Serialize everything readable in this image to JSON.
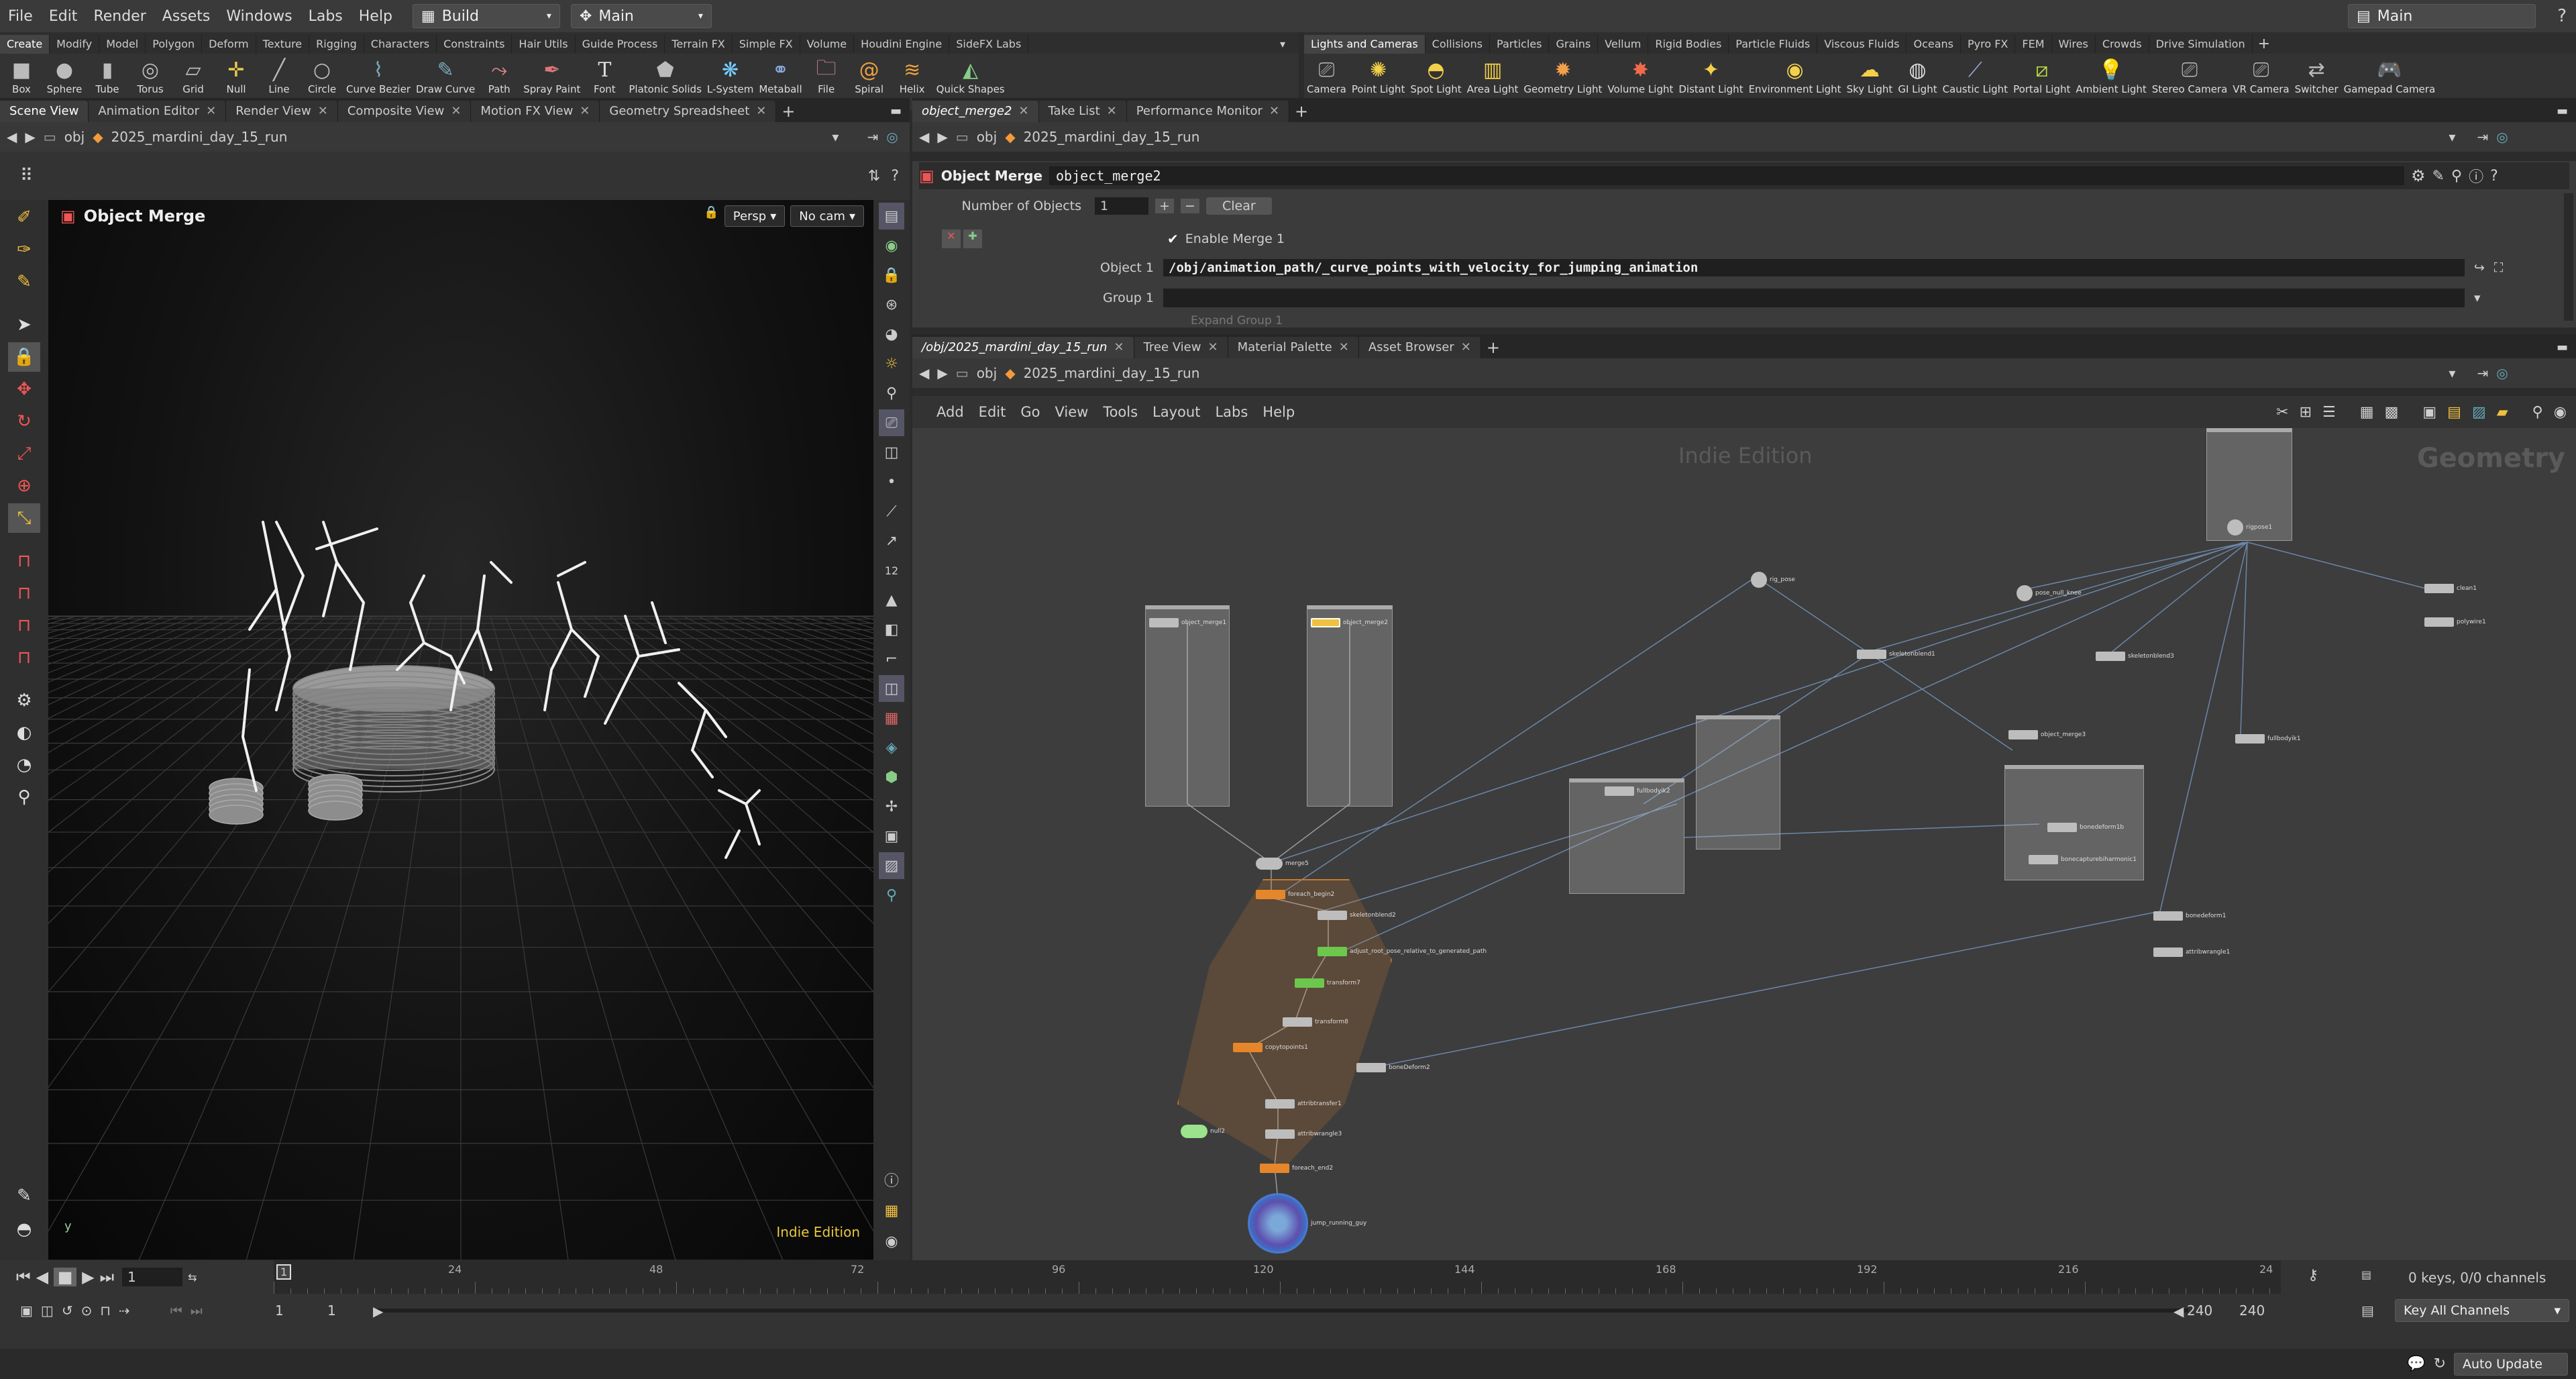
{
  "menubar": {
    "items": [
      "File",
      "Edit",
      "Render",
      "Assets",
      "Windows",
      "Labs",
      "Help"
    ],
    "build_label": "Build",
    "main_label": "Main",
    "right_main_label": "Main"
  },
  "shelf_left": {
    "tabs": [
      "Create",
      "Modify",
      "Model",
      "Polygon",
      "Deform",
      "Texture",
      "Rigging",
      "Characters",
      "Constraints",
      "Hair Utils",
      "Guide Process",
      "Terrain FX",
      "Simple FX",
      "Volume",
      "Houdini Engine",
      "SideFX Labs"
    ],
    "tools": [
      "Box",
      "Sphere",
      "Tube",
      "Torus",
      "Grid",
      "Null",
      "Line",
      "Circle",
      "Curve Bezier",
      "Draw Curve",
      "Path",
      "Spray Paint",
      "Font",
      "Platonic Solids",
      "L-System",
      "Metaball",
      "File",
      "Spiral",
      "Helix",
      "Quick Shapes"
    ]
  },
  "shelf_right": {
    "tabs": [
      "Lights and Cameras",
      "Collisions",
      "Particles",
      "Grains",
      "Vellum",
      "Rigid Bodies",
      "Particle Fluids",
      "Viscous Fluids",
      "Oceans",
      "Pyro FX",
      "FEM",
      "Wires",
      "Crowds",
      "Drive Simulation"
    ],
    "tools": [
      "Camera",
      "Point Light",
      "Spot Light",
      "Area Light",
      "Geometry Light",
      "Volume Light",
      "Distant Light",
      "Environment Light",
      "Sky Light",
      "GI Light",
      "Caustic Light",
      "Portal Light",
      "Ambient Light",
      "Stereo Camera",
      "VR Camera",
      "Switcher",
      "Gamepad Camera"
    ]
  },
  "left_pane": {
    "tabs": [
      "Scene View",
      "Animation Editor",
      "Render View",
      "Composite View",
      "Motion FX View",
      "Geometry Spreadsheet"
    ],
    "path_obj": "obj",
    "path_node": "2025_mardini_day_15_run",
    "viewport_title": "Object Merge",
    "persp_label": "Persp",
    "cam_label": "No cam",
    "edition": "Indie Edition",
    "axis_label": "y"
  },
  "param_pane": {
    "tabs": [
      "object_merge2",
      "Take List",
      "Performance Monitor"
    ],
    "path_obj": "obj",
    "path_node": "2025_mardini_day_15_run",
    "node_type": "Object Merge",
    "node_name": "object_merge2",
    "num_objects_label": "Number of Objects",
    "num_objects_value": "1",
    "clear_label": "Clear",
    "enable_merge_label": "Enable Merge 1",
    "object1_label": "Object 1",
    "object1_value": "/obj/animation_path/_curve_points_with_velocity_for_jumping_animation",
    "group1_label": "Group 1",
    "expand_group_label": "Expand Group 1"
  },
  "network_pane": {
    "tabs": [
      "/obj/2025_mardini_day_15_run",
      "Tree View",
      "Material Palette",
      "Asset Browser"
    ],
    "path_obj": "obj",
    "path_node": "2025_mardini_day_15_run",
    "menu": [
      "Add",
      "Edit",
      "Go",
      "View",
      "Tools",
      "Layout",
      "Labs",
      "Help"
    ],
    "watermark": "Indie Edition",
    "context_label": "Geometry",
    "nodes": [
      "object_merge1",
      "object_merge2",
      "merge5",
      "foreach_begin2",
      "skeletonblend2",
      "adjust_root_pose_relative_to_generated_path",
      "transform7",
      "transform8",
      "copytopoints1",
      "boneDeform2",
      "attribtransfer1",
      "attribwrangle3",
      "null2",
      "foreach_end2",
      "jump_running_guy",
      "rig_pose",
      "pose_null_knee",
      "skeletonblend1",
      "skeletonblend3",
      "bonedeform1",
      "attribwrangle1",
      "polywire1",
      "clean1",
      "rigpose1",
      "fullbodyik1",
      "fullbodyik2",
      "object_merge3",
      "bonedeform1b",
      "bonecapturebiharmonic1"
    ]
  },
  "timeline": {
    "ticks": [
      "24",
      "48",
      "72",
      "96",
      "120",
      "144",
      "168",
      "192",
      "216",
      "24"
    ],
    "current_frame": "1",
    "start_frame": "1",
    "start_frame2": "1",
    "end_frame": "240",
    "end_frame2": "240",
    "keys_label": "0 keys, 0/0 channels",
    "key_all_label": "Key All Channels",
    "auto_update_label": "Auto Update",
    "marker_frame": "1"
  }
}
